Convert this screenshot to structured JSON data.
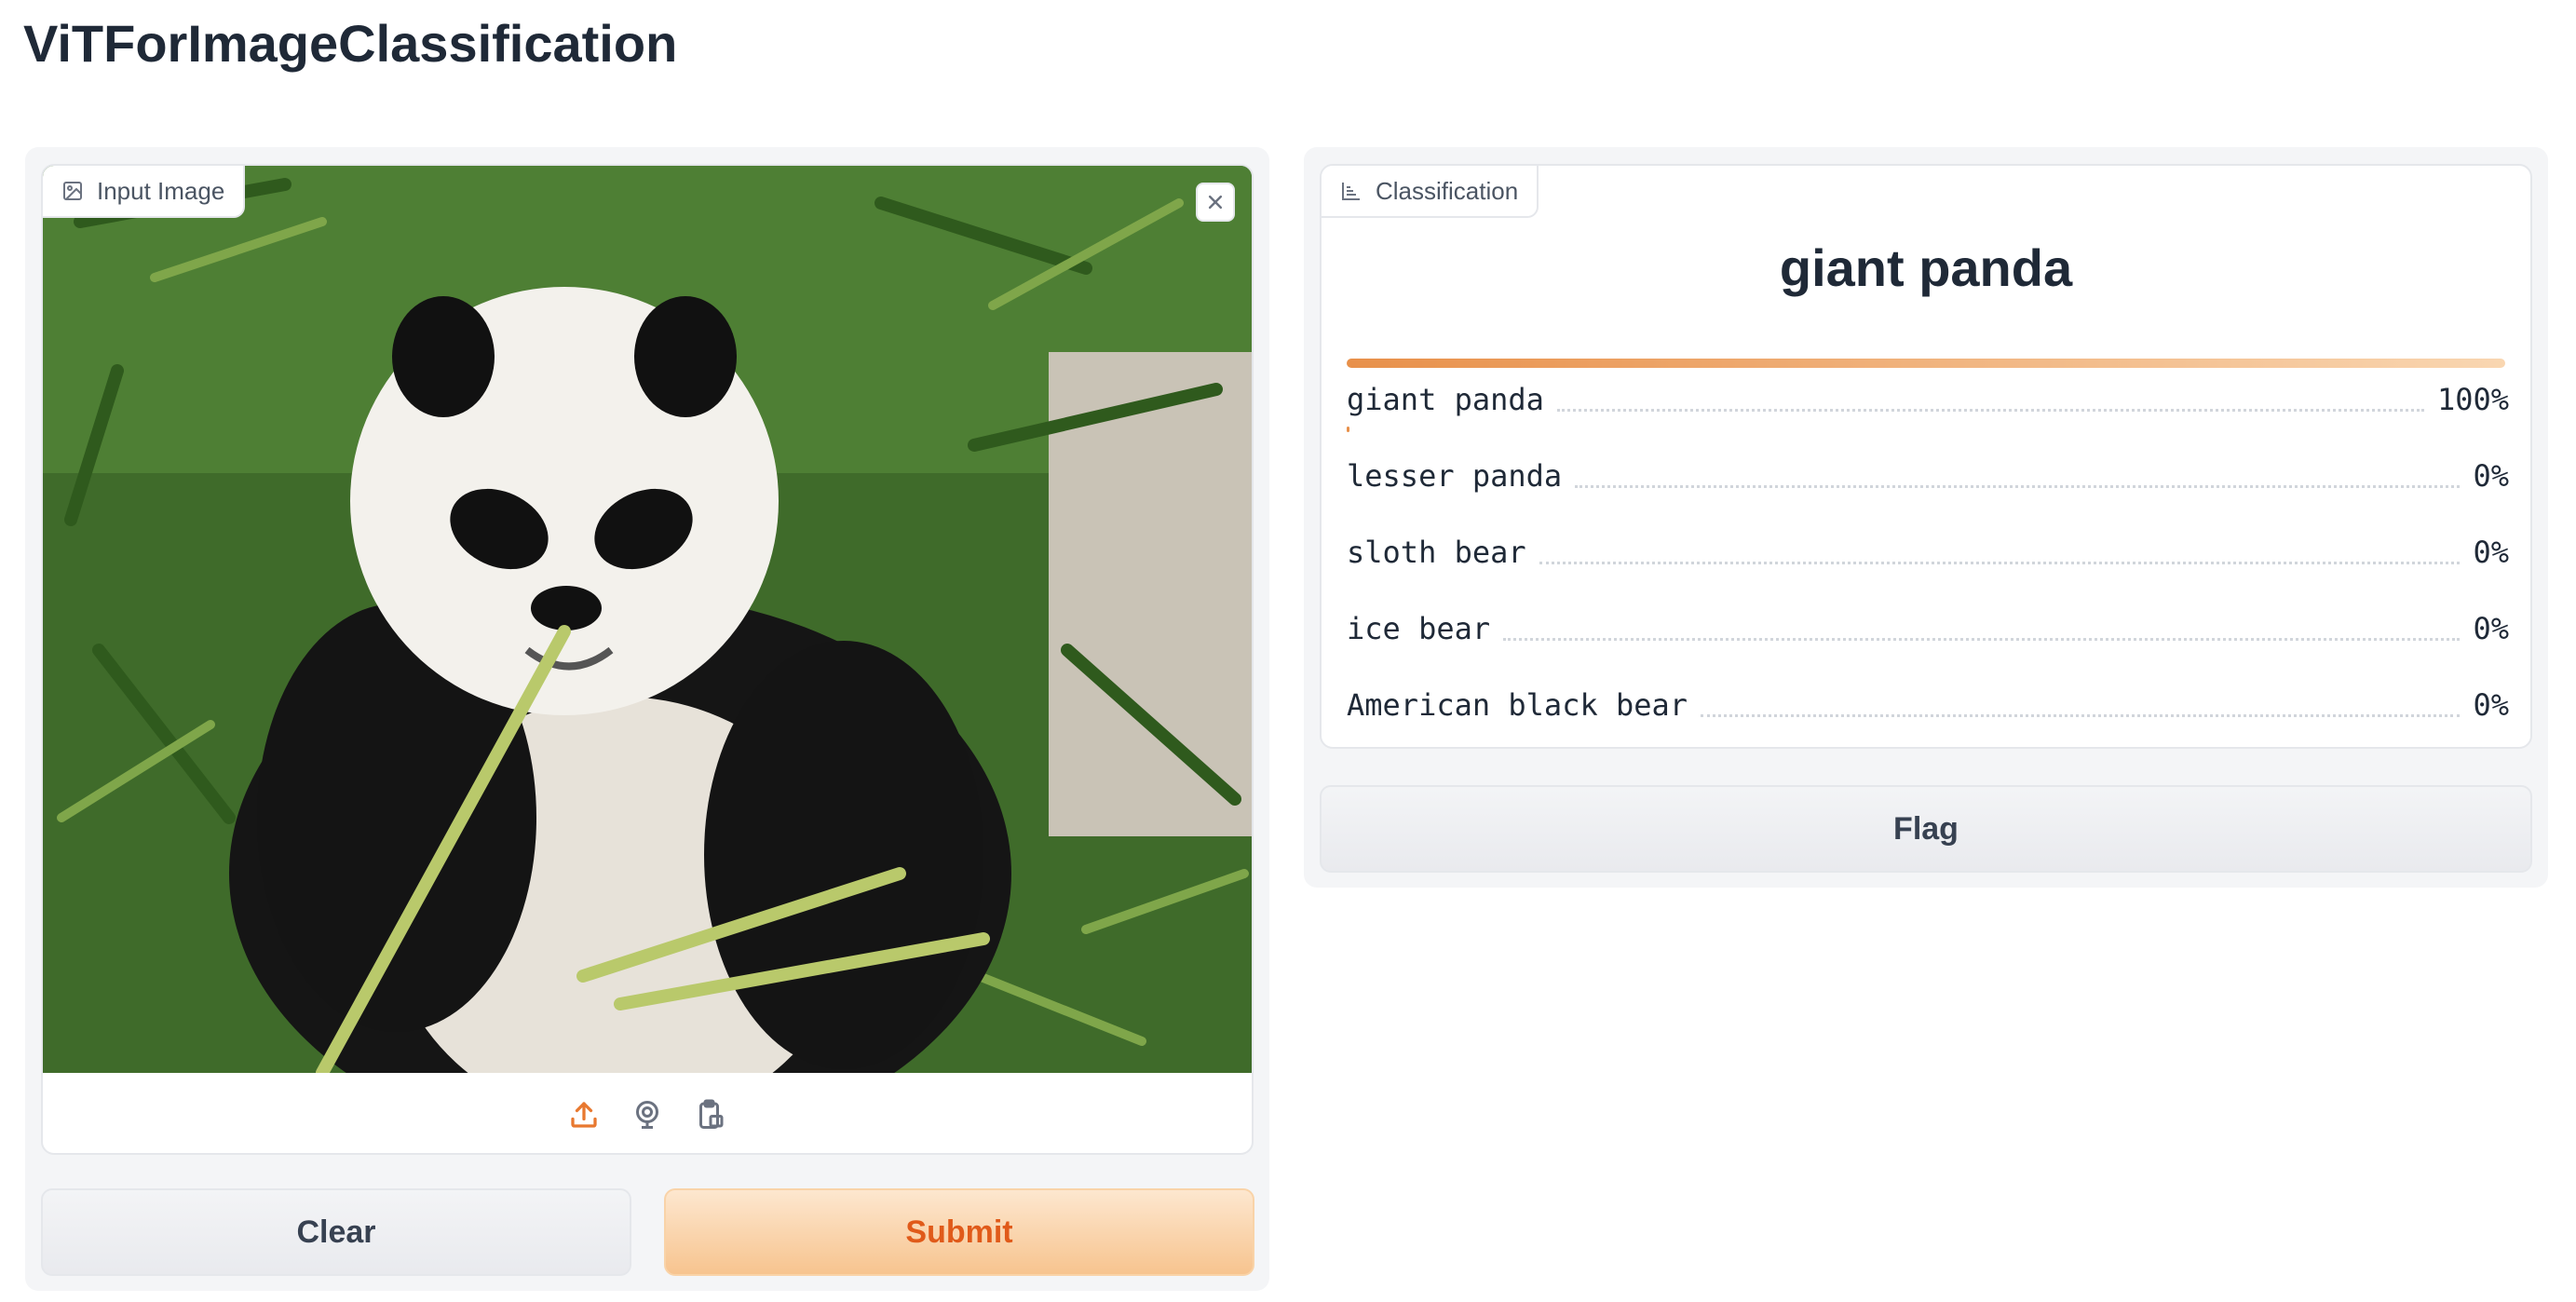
{
  "app": {
    "title": "ViTForImageClassification"
  },
  "input": {
    "label": "Input Image",
    "label_icon": "image-icon",
    "source_icons": [
      "upload-icon",
      "webcam-icon",
      "clipboard-icon"
    ]
  },
  "buttons": {
    "clear": "Clear",
    "submit": "Submit",
    "flag": "Flag"
  },
  "output": {
    "label": "Classification",
    "label_icon": "bar-chart-icon",
    "top_label": "giant panda",
    "results": [
      {
        "label": "giant panda",
        "pct_text": "100%",
        "confidence": 1.0
      },
      {
        "label": "lesser panda",
        "pct_text": "0%",
        "confidence": 0.0
      },
      {
        "label": "sloth bear",
        "pct_text": "0%",
        "confidence": 0.0
      },
      {
        "label": "ice bear",
        "pct_text": "0%",
        "confidence": 0.0
      },
      {
        "label": "American black bear",
        "pct_text": "0%",
        "confidence": 0.0
      }
    ]
  },
  "colors": {
    "accent": "#e8904a",
    "submit_text": "#e05a1a"
  }
}
